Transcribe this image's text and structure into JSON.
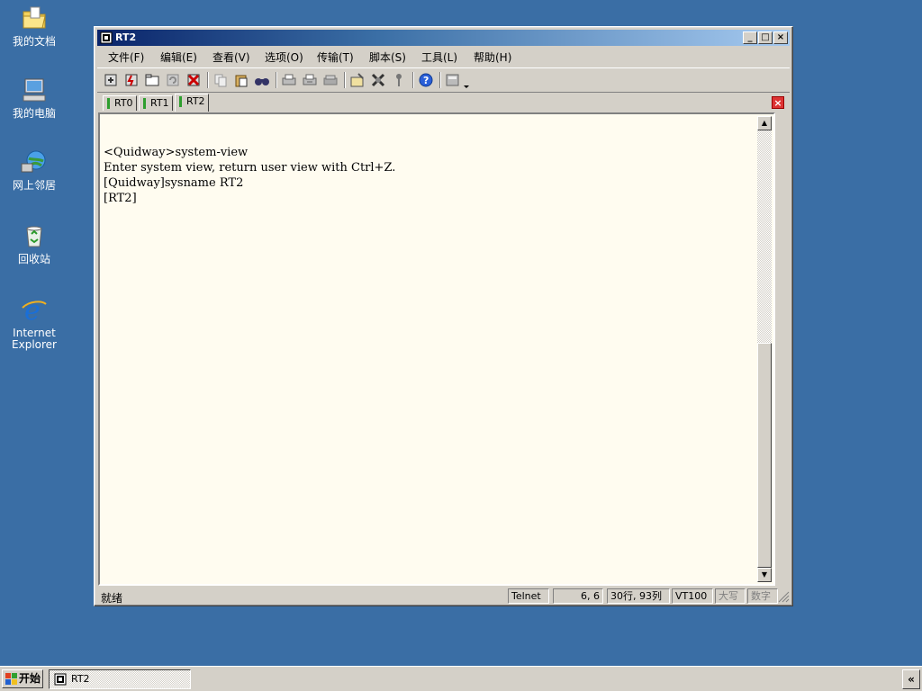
{
  "desktop": {
    "icons": [
      {
        "label": "我的文档"
      },
      {
        "label": "我的电脑"
      },
      {
        "label": "网上邻居"
      },
      {
        "label": "回收站"
      },
      {
        "label": "Internet Explorer"
      }
    ]
  },
  "window": {
    "title": "RT2",
    "controls": {
      "minimize": "_",
      "maximize": "□",
      "close": "×"
    },
    "menu": [
      "文件(F)",
      "编辑(E)",
      "查看(V)",
      "选项(O)",
      "传输(T)",
      "脚本(S)",
      "工具(L)",
      "帮助(H)"
    ],
    "tabs": [
      {
        "label": "RT0",
        "active": false
      },
      {
        "label": "RT1",
        "active": false
      },
      {
        "label": "RT2",
        "active": true
      }
    ],
    "tab_close": "×",
    "terminal_lines": [
      "<Quidway>system-view",
      "Enter system view, return user view with Ctrl+Z.",
      "[Quidway]sysname RT2",
      "[RT2]"
    ],
    "status": {
      "ready": "就绪",
      "protocol": "Telnet",
      "cursor": "6,    6",
      "size": "30行, 93列",
      "emulation": "VT100",
      "caps": "大写",
      "num": "数字"
    }
  },
  "taskbar": {
    "start_label": "开始",
    "task_label": "RT2",
    "tray_button": "«"
  },
  "colors": {
    "desktop": "#3a6ea5",
    "terminal_bg": "#fffcf0",
    "title_active": "#0a246a"
  }
}
